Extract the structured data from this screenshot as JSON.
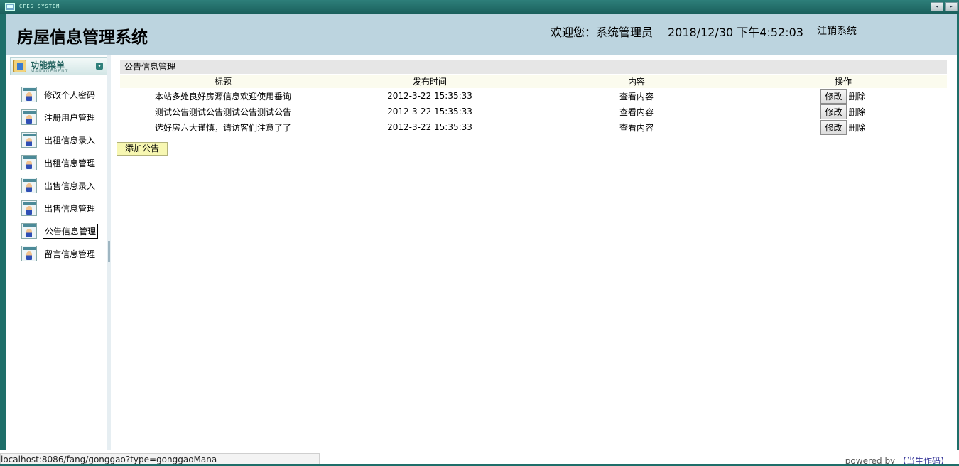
{
  "window": {
    "system_text": "CFES SYSTEM",
    "nav_prev": "◂",
    "nav_next": "▸"
  },
  "header": {
    "title": "房屋信息管理系统",
    "welcome": "欢迎您：系统管理员",
    "datetime": "2018/12/30 下午4:52:03",
    "logout": "注销系统"
  },
  "menu": {
    "title": "功能菜单",
    "subtitle": "MANAGEMENT",
    "items": [
      {
        "label": "修改个人密码"
      },
      {
        "label": "注册用户管理"
      },
      {
        "label": "出租信息录入"
      },
      {
        "label": "出租信息管理"
      },
      {
        "label": "出售信息录入"
      },
      {
        "label": "出售信息管理"
      },
      {
        "label": "公告信息管理",
        "active": true
      },
      {
        "label": "留言信息管理"
      }
    ]
  },
  "panel": {
    "title": "公告信息管理",
    "columns": [
      "标题",
      "发布时间",
      "内容",
      "操作"
    ],
    "rows": [
      {
        "title": "本站多处良好房源信息欢迎使用垂询",
        "time": "2012-3-22 15:35:33",
        "content": "查看内容",
        "edit": "修改",
        "delete": "删除"
      },
      {
        "title": "测试公告测试公告测试公告测试公告",
        "time": "2012-3-22 15:35:33",
        "content": "查看内容",
        "edit": "修改",
        "delete": "删除"
      },
      {
        "title": "选好房六大谨慎，请访客们注意了了",
        "time": "2012-3-22 15:35:33",
        "content": "查看内容",
        "edit": "修改",
        "delete": "删除"
      }
    ],
    "add_button": "添加公告"
  },
  "status": {
    "url": "localhost:8086/fang/gonggao?type=gonggaoMana",
    "powered_by": "powered by",
    "author": "【当生作码】"
  }
}
